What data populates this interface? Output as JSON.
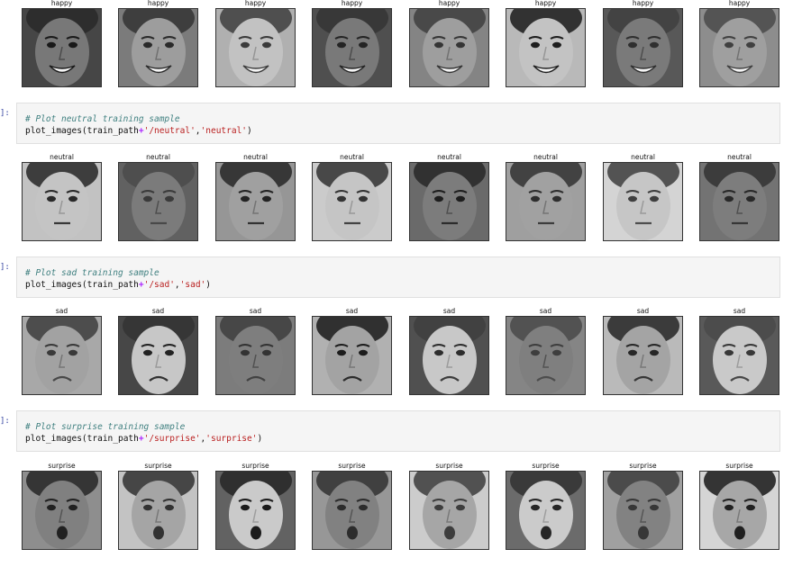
{
  "notebook": {
    "prompt_label": "]:",
    "image_rows": [
      {
        "labels": [
          "happy",
          "happy",
          "happy",
          "happy",
          "happy",
          "happy",
          "happy",
          "happy"
        ]
      },
      {
        "labels": [
          "neutral",
          "neutral",
          "neutral",
          "neutral",
          "neutral",
          "neutral",
          "neutral",
          "neutral"
        ]
      },
      {
        "labels": [
          "sad",
          "sad",
          "sad",
          "sad",
          "sad",
          "sad",
          "sad",
          "sad"
        ]
      },
      {
        "labels": [
          "surprise",
          "surprise",
          "surprise",
          "surprise",
          "surprise",
          "surprise",
          "surprise",
          "surprise"
        ]
      }
    ],
    "code_cells": [
      {
        "comment": "# Plot neutral training sample",
        "call": {
          "func": "plot_images",
          "var": "train_path",
          "op": "+",
          "path": "'/neutral'",
          "label": "'neutral'"
        }
      },
      {
        "comment": "# Plot sad training sample",
        "call": {
          "func": "plot_images",
          "var": "train_path",
          "op": "+",
          "path": "'/sad'",
          "label": "'sad'"
        }
      },
      {
        "comment": "# Plot surprise training sample",
        "call": {
          "func": "plot_images",
          "var": "train_path",
          "op": "+",
          "path": "'/surprise'",
          "label": "'surprise'"
        }
      }
    ]
  },
  "colors": {
    "code_background": "#f5f5f5",
    "comment": "#408080",
    "string": "#ba2121",
    "operator": "#aa22ff",
    "prompt": "#303f9f"
  }
}
